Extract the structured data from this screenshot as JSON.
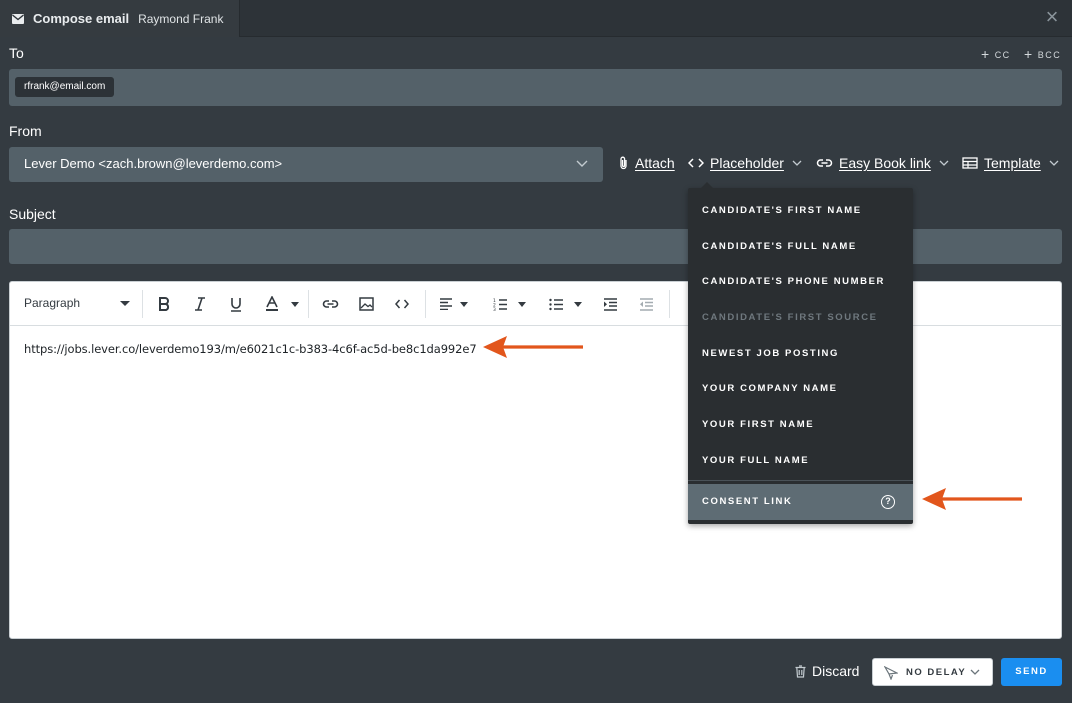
{
  "window": {
    "title": "Compose email",
    "recipient_name": "Raymond Frank"
  },
  "to": {
    "label": "To",
    "cc_label": "CC",
    "bcc_label": "BCC",
    "recipients": [
      "rfrank@email.com"
    ]
  },
  "from": {
    "label": "From",
    "value": "Lever Demo <zach.brown@leverdemo.com>"
  },
  "actions": {
    "attach": "Attach",
    "placeholder": "Placeholder",
    "easy_book_link": "Easy Book link",
    "template": "Template"
  },
  "subject": {
    "label": "Subject",
    "value": ""
  },
  "editor": {
    "block_format": "Paragraph",
    "body_text": "https://jobs.lever.co/leverdemo193/m/e6021c1c-b383-4c6f-ac5d-be8c1da992e7"
  },
  "placeholder_menu": {
    "items": [
      {
        "label": "CANDIDATE'S FIRST NAME",
        "disabled": false
      },
      {
        "label": "CANDIDATE'S FULL NAME",
        "disabled": false
      },
      {
        "label": "CANDIDATE'S PHONE NUMBER",
        "disabled": false
      },
      {
        "label": "CANDIDATE'S FIRST SOURCE",
        "disabled": true
      },
      {
        "label": "NEWEST JOB POSTING",
        "disabled": false
      },
      {
        "label": "YOUR COMPANY NAME",
        "disabled": false
      },
      {
        "label": "YOUR FIRST NAME",
        "disabled": false
      },
      {
        "label": "YOUR FULL NAME",
        "disabled": false
      }
    ],
    "consent_link": "CONSENT LINK",
    "help_glyph": "?"
  },
  "footer": {
    "discard": "Discard",
    "delay": "NO DELAY",
    "send": "SEND"
  },
  "colors": {
    "background": "#343b41",
    "field": "#546169",
    "menu": "#2a2e31",
    "menu_highlight": "#5e6c74",
    "send_button": "#1a8ef0",
    "annotation_arrow": "#e2561c"
  },
  "icons": [
    "mail-icon",
    "close-icon",
    "plus-icon",
    "chevron-down-icon",
    "paperclip-icon",
    "code-icon",
    "link-icon",
    "table-icon",
    "bold-icon",
    "italic-icon",
    "underline-icon",
    "text-color-icon",
    "image-icon",
    "align-icon",
    "ordered-list-icon",
    "bullet-list-icon",
    "indent-icon",
    "outdent-icon",
    "help-icon",
    "trash-icon",
    "send-delay-icon",
    "arrow-annotation-icon"
  ]
}
